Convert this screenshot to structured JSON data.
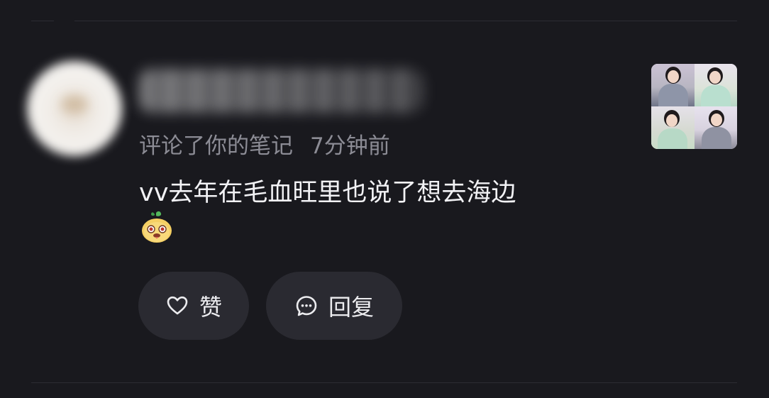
{
  "notification": {
    "username": "",
    "action": "评论了你的笔记",
    "time": "7分钟前",
    "comment": "vv去年在毛血旺里也说了想去海边",
    "emoji": "mango-face-emoji"
  },
  "actions": {
    "like_label": "赞",
    "reply_label": "回复"
  },
  "colors": {
    "background": "#19191e",
    "button": "#2a2a31",
    "text_primary": "#f2f2f5",
    "text_secondary": "#8c8c95",
    "divider": "#2c2c33"
  },
  "icons": {
    "like": "heart-icon",
    "reply": "comment-bubble-icon"
  }
}
